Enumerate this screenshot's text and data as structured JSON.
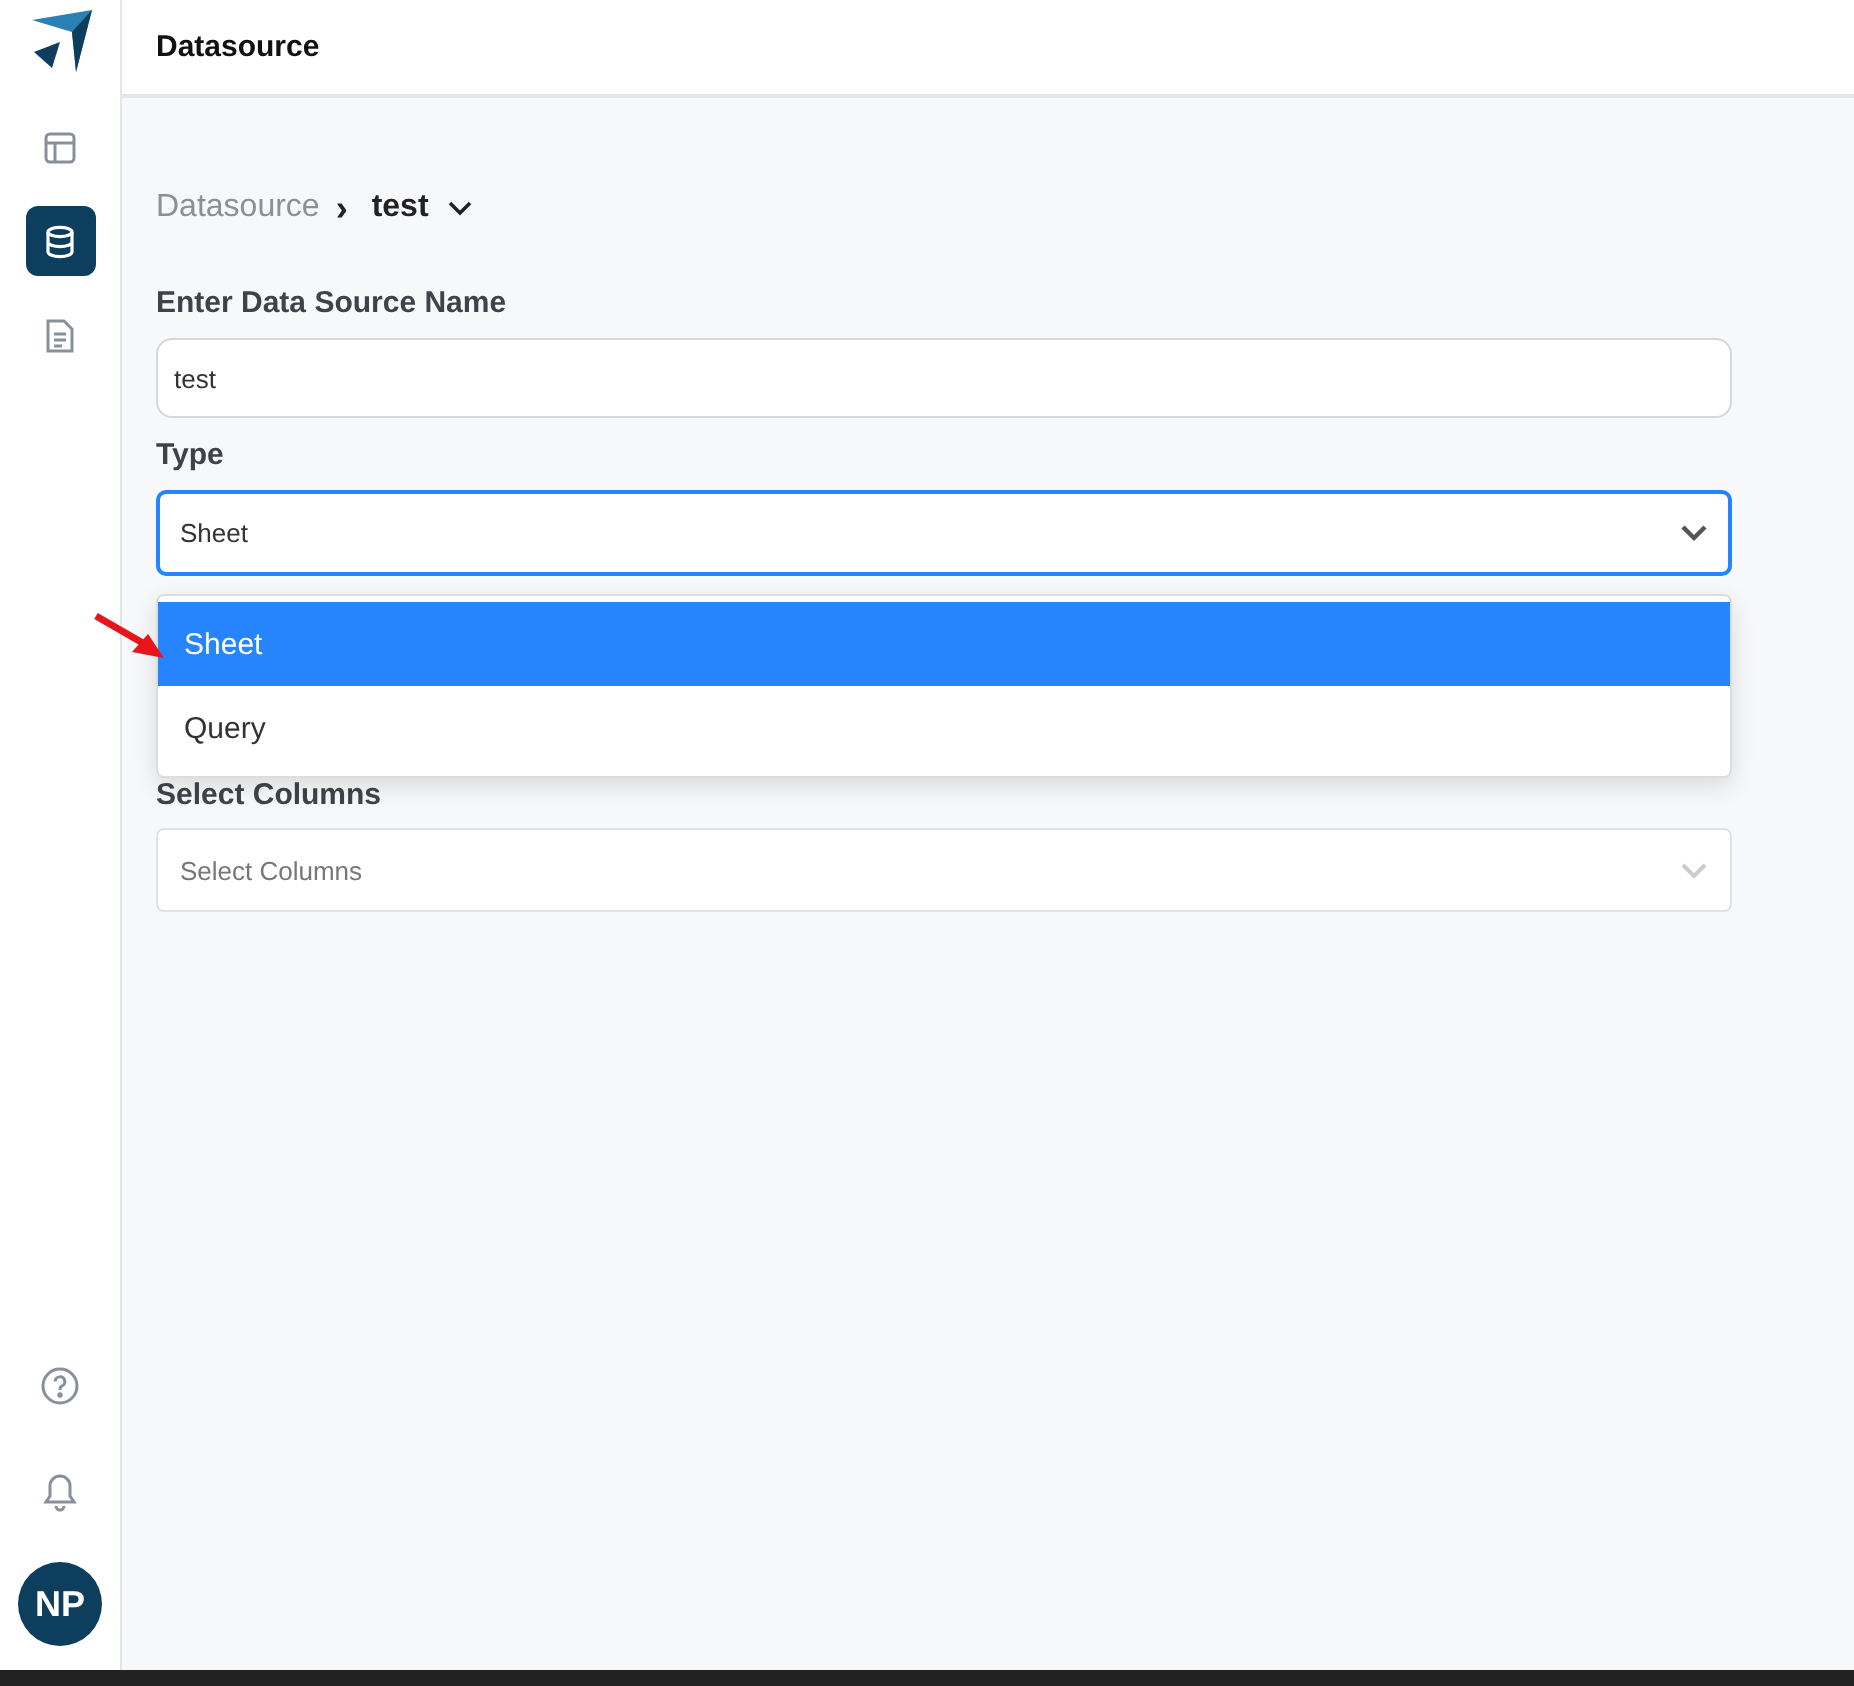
{
  "sidebar": {
    "items": [
      {
        "kind": "layout",
        "selected": false
      },
      {
        "kind": "database",
        "selected": true
      },
      {
        "kind": "document",
        "selected": false
      }
    ],
    "bottom": [
      {
        "kind": "help"
      },
      {
        "kind": "bell"
      }
    ],
    "avatar": {
      "initials": "NP"
    }
  },
  "header": {
    "title": "Datasource"
  },
  "breadcrumb": {
    "parent": "Datasource",
    "separator": "›",
    "current": "test"
  },
  "form": {
    "name_label": "Enter Data Source Name",
    "name_value": "test",
    "type_label": "Type",
    "type_value": "Sheet",
    "type_open": true,
    "type_options": [
      {
        "label": "Sheet",
        "selected": true
      },
      {
        "label": "Query",
        "selected": false
      }
    ],
    "columns_label": "Select Columns",
    "columns_placeholder": "Select Columns"
  }
}
